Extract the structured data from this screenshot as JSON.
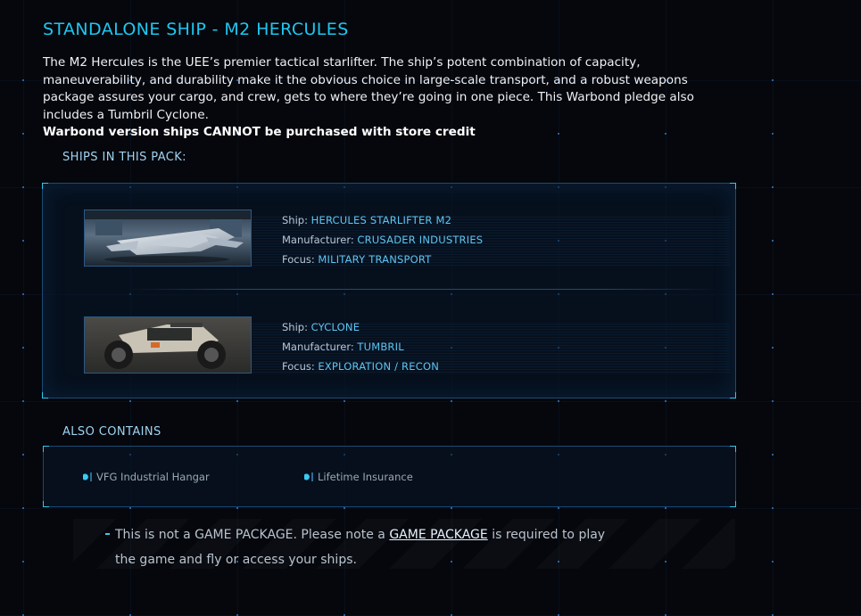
{
  "header": {
    "title": "STANDALONE SHIP - M2 HERCULES"
  },
  "description": {
    "text": "The M2 Hercules is the UEE’s premier tactical starlifter. The ship’s potent combination of capacity, maneuverability, and durability make it the obvious choice in large-scale transport, and a robust weapons package assures your cargo, and crew, gets to where they’re going in one piece. This Warbond pledge also includes a Tumbril Cyclone.",
    "warning": "Warbond version ships CANNOT be purchased with store credit"
  },
  "ships_section": {
    "heading": "SHIPS IN THIS PACK:",
    "labels": {
      "ship": "Ship: ",
      "manufacturer": "Manufacturer: ",
      "focus": "Focus: "
    },
    "ships": [
      {
        "name": "HERCULES STARLIFTER M2",
        "manufacturer": "CRUSADER INDUSTRIES",
        "focus": "MILITARY TRANSPORT",
        "image_icon": "starlifter-ship-image"
      },
      {
        "name": "CYCLONE",
        "manufacturer": "TUMBRIL",
        "focus": "EXPLORATION / RECON",
        "image_icon": "cyclone-vehicle-image"
      }
    ]
  },
  "contains_section": {
    "heading": "ALSO CONTAINS",
    "items": [
      "VFG Industrial Hangar",
      "Lifetime Insurance"
    ]
  },
  "notice": {
    "prefix": "This is not a GAME PACKAGE. Please note a ",
    "link": "GAME PACKAGE",
    "suffix_line1": " is required to play",
    "line2": "the game and fly or access your ships."
  },
  "colors": {
    "accent": "#1fc6f0",
    "value": "#5fc4f2",
    "background": "#05070c",
    "border": "#1b4a74"
  }
}
